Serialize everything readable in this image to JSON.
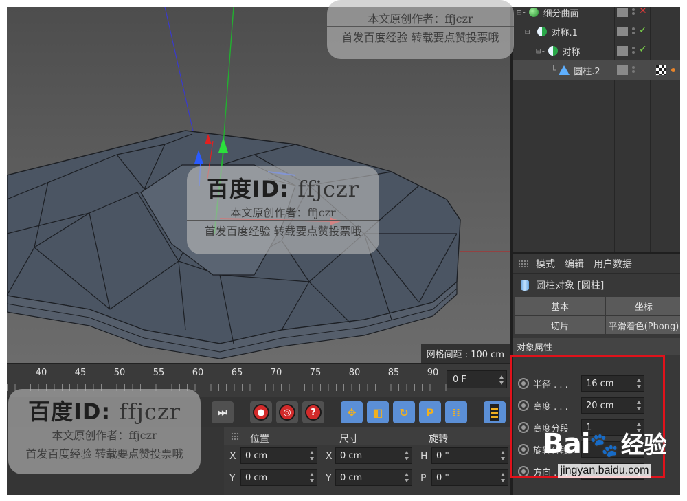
{
  "viewport": {
    "grid_spacing": "网格间距 : 100 cm"
  },
  "object_manager": {
    "items": [
      {
        "label": "细分曲面",
        "status": "✕"
      },
      {
        "label": "对称.1",
        "status": "✓"
      },
      {
        "label": "对称",
        "status": "✓"
      },
      {
        "label": "圆柱.2",
        "status": ""
      }
    ]
  },
  "attributes": {
    "menu": [
      "模式",
      "编辑",
      "用户数据"
    ],
    "object_title": "圆柱对象 [圆柱]",
    "tabs": [
      "基本",
      "坐标",
      "切片",
      "平滑着色(Phong)"
    ],
    "section": "对象属性",
    "props": [
      {
        "label": "半径 . . .",
        "value": "16 cm"
      },
      {
        "label": "高度 . . .",
        "value": "20 cm"
      },
      {
        "label": "高度分段",
        "value": "1"
      },
      {
        "label": "旋转分段",
        "value": ""
      },
      {
        "label": "方向 . . .",
        "value": ""
      }
    ]
  },
  "timeline": {
    "ticks": [
      "40",
      "45",
      "50",
      "55",
      "60",
      "65",
      "70",
      "75",
      "80",
      "85",
      "90"
    ],
    "current_frame": "0 F"
  },
  "toolbar": {
    "goto_end_label": "⏭",
    "key_labels": [
      "●",
      "◎",
      "?"
    ],
    "tool_labels": [
      "✥",
      "◧",
      "↻",
      "P",
      "⁞⁞"
    ]
  },
  "coordinates": {
    "headers": [
      "位置",
      "尺寸",
      "旋转"
    ],
    "rows": [
      {
        "axes": [
          "X",
          "X",
          "H"
        ],
        "values": [
          "0 cm",
          "0 cm",
          "0 °"
        ]
      },
      {
        "axes": [
          "Y",
          "Y",
          "P"
        ],
        "values": [
          "0 cm",
          "0 cm",
          "0 °"
        ]
      }
    ]
  },
  "watermarks": {
    "id_prefix": "百度ID:",
    "id_name": "ffjczr",
    "line1": "本文原创作者：ffjczr",
    "line2": "首发百度经验 转载要点赞投票哦",
    "logo_text": "Bai",
    "logo_cn": "经验",
    "logo_url": "jingyan.baidu.com"
  },
  "colors": {
    "accent_blue": "#5b8fd6",
    "highlight_red": "#e0121b",
    "status_green": "#7bd34a",
    "status_red": "#e23a3a"
  }
}
